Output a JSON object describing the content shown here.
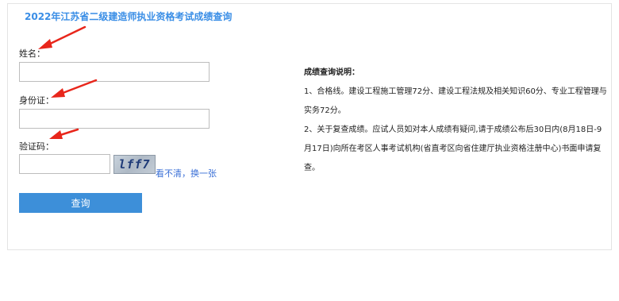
{
  "page": {
    "title": "2022年江苏省二级建造师执业资格考试成绩查询"
  },
  "form": {
    "name_label": "姓名：",
    "name_value": "",
    "id_label": "身份证：",
    "id_value": "",
    "captcha_label": "验证码：",
    "captcha_value": "",
    "captcha_text": "lff7",
    "refresh_label": "看不清，换一张",
    "submit_label": "查询"
  },
  "notes": {
    "heading": "成绩查询说明：",
    "item1": "1、合格线。建设工程施工管理72分、建设工程法规及相关知识60分、专业工程管理与实务72分。",
    "item2": "2、关于复查成绩。应试人员如对本人成绩有疑问,请于成绩公布后30日内(8月18日-9月17日)向所在考区人事考试机构(省直考区向省住建厅执业资格注册中心)书面申请复查。"
  },
  "colors": {
    "accent": "#3d8fd9",
    "title": "#3a8ee6",
    "arrow": "#e8261b"
  }
}
